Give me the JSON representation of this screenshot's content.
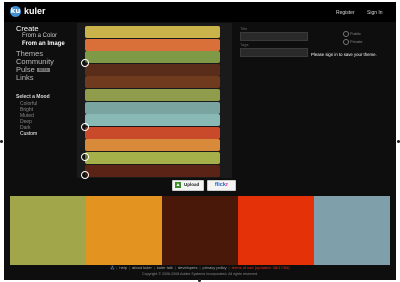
{
  "header": {
    "logo_letter": "ku",
    "app_name": "kuler",
    "register": "Register",
    "sign_in": "Sign In"
  },
  "nav": {
    "create": "Create",
    "from_color": "From a Color",
    "from_image": "From an Image",
    "themes": "Themes",
    "community": "Community",
    "pulse": "Pulse",
    "pulse_badge": "BETA",
    "links": "Links"
  },
  "mood": {
    "title": "Select a Mood",
    "items": [
      "Colorful",
      "Bright",
      "Muted",
      "Deep",
      "Dark",
      "Custom"
    ],
    "selected": "Custom"
  },
  "theme_form": {
    "title_label": "Title",
    "tags_label": "Tags",
    "public_label": "Public",
    "private_label": "Private",
    "signin_message": "Please sign in to save your theme."
  },
  "image_fabrics": [
    "#c9b34a",
    "#d9703a",
    "#7f9a46",
    "#5a2c1a",
    "#6f3a1e",
    "#8f9c4c",
    "#7aa4a0",
    "#89b9b5",
    "#c84a2a",
    "#d88a3a",
    "#a6b04a",
    "#5a2316"
  ],
  "buttons": {
    "upload": "Upload",
    "flickr_a": "flick",
    "flickr_b": "r"
  },
  "palette": [
    "#a1a64a",
    "#e3931f",
    "#4a1808",
    "#e53107",
    "#7fa0aa"
  ],
  "footer": {
    "links": [
      "help",
      "about kuler",
      "kuler talk",
      "developers",
      "privacy policy"
    ],
    "terms": "terms of use (updated: 08/17/06)",
    "copyright": "Copyright © 2006-2008 Adobe Systems Incorporated. All rights reserved."
  }
}
